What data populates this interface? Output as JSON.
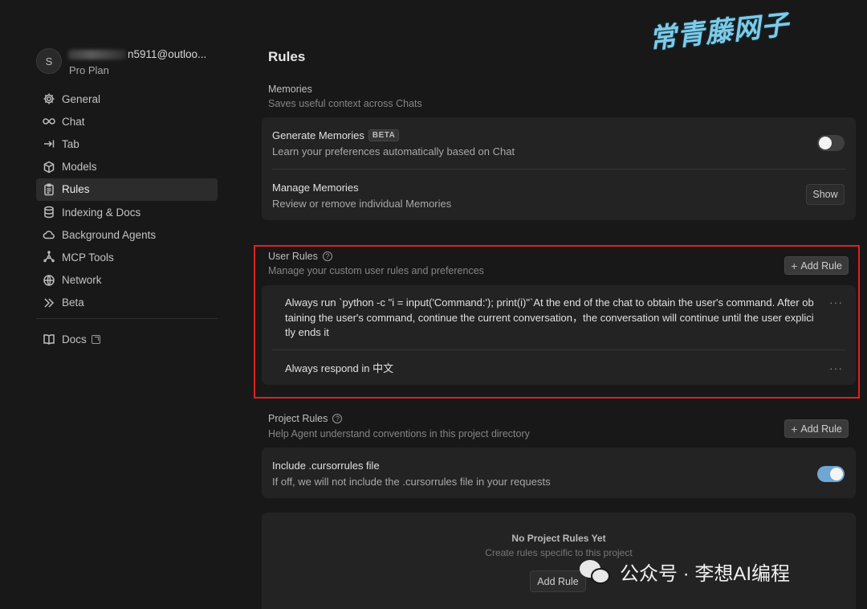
{
  "account": {
    "avatar_letter": "S",
    "email_visible": "n5911@outloo...",
    "plan": "Pro Plan"
  },
  "sidebar": {
    "items": [
      {
        "label": "General",
        "icon": "gear-icon",
        "active": false
      },
      {
        "label": "Chat",
        "icon": "infinity-icon",
        "active": false
      },
      {
        "label": "Tab",
        "icon": "arrow-tab-icon",
        "active": false
      },
      {
        "label": "Models",
        "icon": "cube-icon",
        "active": false
      },
      {
        "label": "Rules",
        "icon": "clipboard-icon",
        "active": true
      },
      {
        "label": "Indexing & Docs",
        "icon": "database-icon",
        "active": false
      },
      {
        "label": "Background Agents",
        "icon": "cloud-icon",
        "active": false
      },
      {
        "label": "MCP Tools",
        "icon": "nodes-icon",
        "active": false
      },
      {
        "label": "Network",
        "icon": "globe-icon",
        "active": false
      },
      {
        "label": "Beta",
        "icon": "double-chevron-icon",
        "active": false
      }
    ],
    "docs_label": "Docs"
  },
  "page": {
    "title": "Rules"
  },
  "memories": {
    "title": "Memories",
    "subtitle": "Saves useful context across Chats",
    "generate": {
      "title": "Generate Memories",
      "badge": "BETA",
      "subtitle": "Learn your preferences automatically based on Chat",
      "enabled": false
    },
    "manage": {
      "title": "Manage Memories",
      "subtitle": "Review or remove individual Memories",
      "button": "Show"
    }
  },
  "user_rules": {
    "title": "User Rules",
    "subtitle": "Manage your custom user rules and preferences",
    "add_button": "Add Rule",
    "rules": [
      "Always run `python -c \"i = input('Command:'); print(i)\"`At the end of the chat to obtain the user's command. After obtaining the user's command, continue the current conversation，the conversation will continue until the user explicitly ends it",
      "Always respond in 中文"
    ],
    "more_menu": "···"
  },
  "project_rules": {
    "title": "Project Rules",
    "subtitle": "Help Agent understand conventions in this project directory",
    "add_button": "Add Rule",
    "cursorrules": {
      "title": "Include .cursorrules file",
      "subtitle": "If off, we will not include the .cursorrules file in your requests",
      "enabled": true
    },
    "empty": {
      "title": "No Project Rules Yet",
      "subtitle": "Create rules specific to this project",
      "button": "Add Rule"
    }
  },
  "watermarks": {
    "top": "常青藤网子",
    "bottom": "公众号 · 李想AI编程"
  },
  "colors": {
    "background": "#181818",
    "card": "#232323",
    "toggle_on": "#6ea7d3",
    "highlight_box": "#e02020",
    "watermark_top": "#7ecbe8"
  }
}
